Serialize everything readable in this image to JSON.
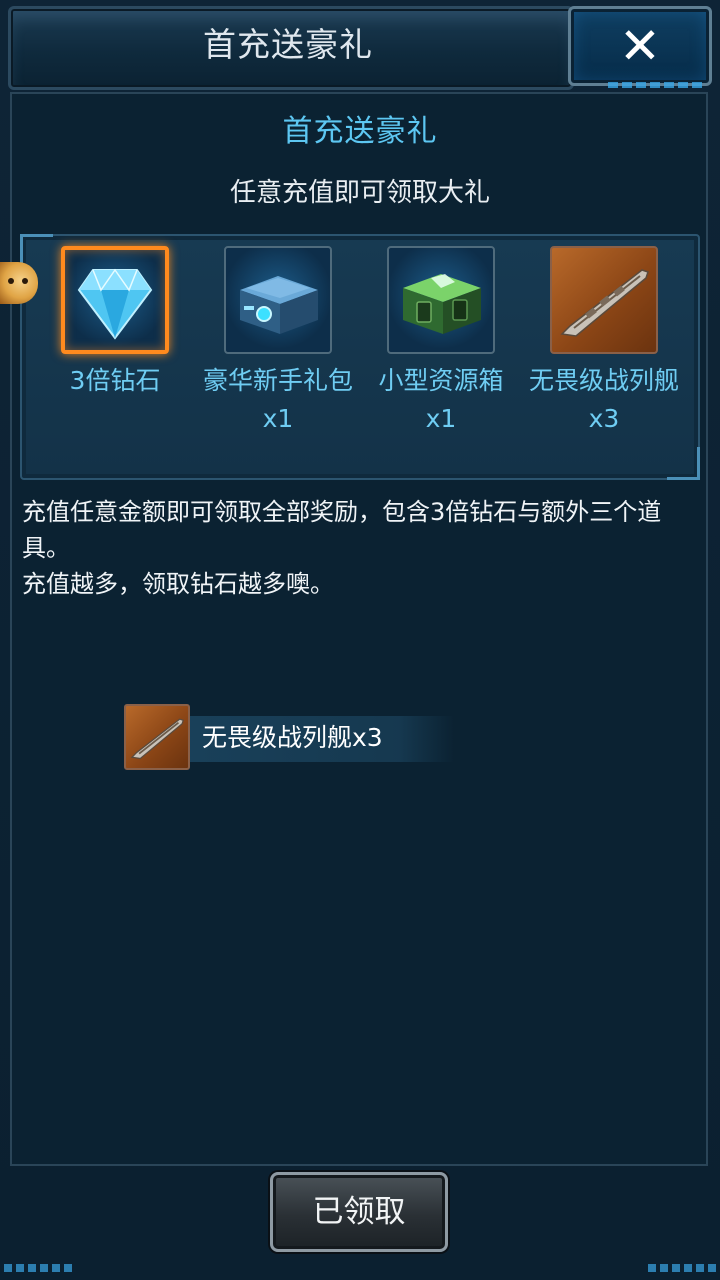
{
  "header": {
    "title": "首充送豪礼",
    "close_icon": "close-x-icon"
  },
  "panel": {
    "title": "首充送豪礼",
    "subtitle": "任意充值即可领取大礼"
  },
  "rewards": [
    {
      "label": "3倍钻石",
      "icon": "diamond-icon",
      "selected": true
    },
    {
      "label": "豪华新手礼包 x1",
      "icon": "blue-chest-icon",
      "selected": false
    },
    {
      "label": "小型资源箱 x1",
      "icon": "green-chest-icon",
      "selected": false
    },
    {
      "label": "无畏级战列舰 x3",
      "icon": "battleship-icon",
      "selected": false
    }
  ],
  "description": {
    "line1": "充值任意金额即可领取全部奖励，包含3倍钻石与额外三个道具。",
    "line2": "充值越多，领取钻石越多噢。"
  },
  "toast": {
    "text": "无畏级战列舰x3",
    "icon": "battleship-icon"
  },
  "claim_button": {
    "label": "已领取"
  },
  "colors": {
    "accent_blue": "#5dc7f2",
    "selected_orange": "#ff8a1e",
    "background": "#0b2232"
  }
}
